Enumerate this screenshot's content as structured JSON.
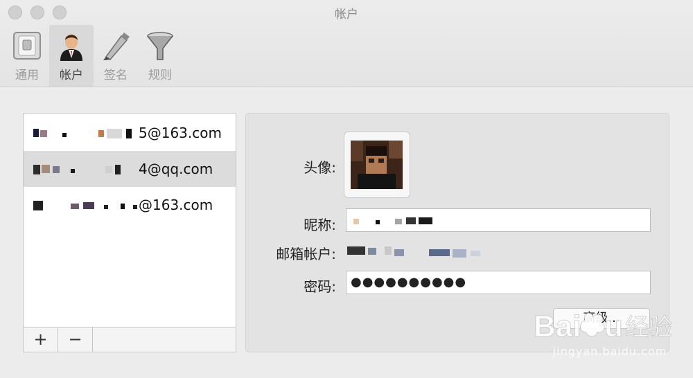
{
  "window": {
    "title": "帐户"
  },
  "toolbar": {
    "tabs": [
      {
        "label": "通用",
        "icon": "switch-icon"
      },
      {
        "label": "帐户",
        "icon": "user-icon",
        "active": true
      },
      {
        "label": "签名",
        "icon": "pen-icon"
      },
      {
        "label": "规则",
        "icon": "funnel-icon"
      }
    ]
  },
  "accounts": {
    "items": [
      {
        "address_visible": "5@163.com"
      },
      {
        "address_visible": "4@qq.com",
        "selected": true
      },
      {
        "address_visible": "@163.com"
      }
    ],
    "add_label": "+",
    "remove_label": "−"
  },
  "details": {
    "avatar_label": "头像:",
    "nickname_label": "昵称:",
    "email_label": "邮箱帐户:",
    "password_label": "密码:",
    "password_value": "●●●●●●●●●●",
    "advanced_label": "高级..."
  },
  "watermark": {
    "site": "jingyan.baidu.com",
    "logo_text": "Baidu 经验"
  },
  "colors": {
    "window_bg": "#ececec",
    "selected_row": "#dcdcdc",
    "panel_bg": "#e3e3e3"
  }
}
